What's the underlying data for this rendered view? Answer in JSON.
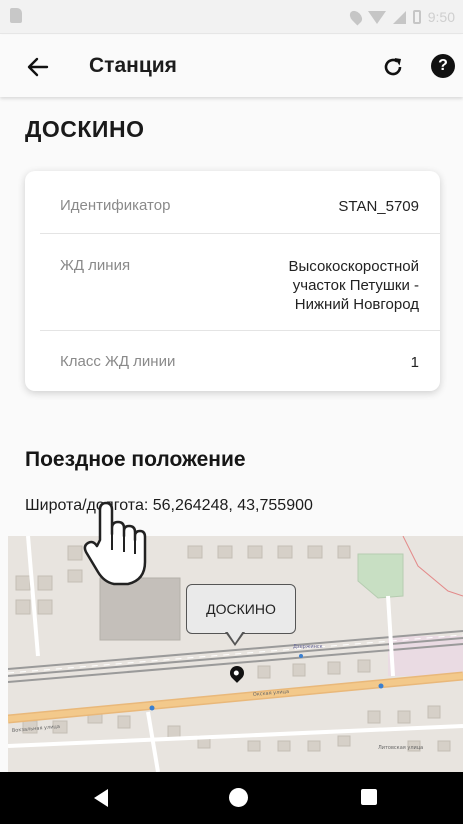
{
  "status_bar": {
    "time": "9:50",
    "icons": [
      "sim-card-icon",
      "location-icon",
      "wifi-icon",
      "signal-icon",
      "battery-icon"
    ]
  },
  "app_bar": {
    "title": "Станция",
    "back_icon": "arrow-left-icon",
    "refresh_icon": "refresh-icon",
    "help_icon": "help-icon",
    "help_glyph": "?"
  },
  "station": {
    "name": "ДОСКИНО"
  },
  "info_card": {
    "rows": [
      {
        "label": "Идентификатор",
        "value": "STAN_5709"
      },
      {
        "label": "ЖД линия",
        "value": "Высокоскоростной участок Петушки - Нижний Новгород"
      },
      {
        "label": "Класс ЖД линии",
        "value": "1"
      }
    ]
  },
  "position": {
    "title": "Поездное положение",
    "coords": "Широта/долгота: 56,264248, 43,755900"
  },
  "map": {
    "marker_label": "ДОСКИНО",
    "street_labels": [
      "Вокзальная улица",
      "Окская улица",
      "Литовская улица",
      "Дзержинск"
    ]
  },
  "colors": {
    "accent": "#111111",
    "map_road": "#f3c98b",
    "map_green": "#c8dfc3",
    "nav_bar": "#000000"
  },
  "nav_bar": {
    "icons": [
      "nav-back-icon",
      "nav-home-icon",
      "nav-recent-icon"
    ]
  }
}
